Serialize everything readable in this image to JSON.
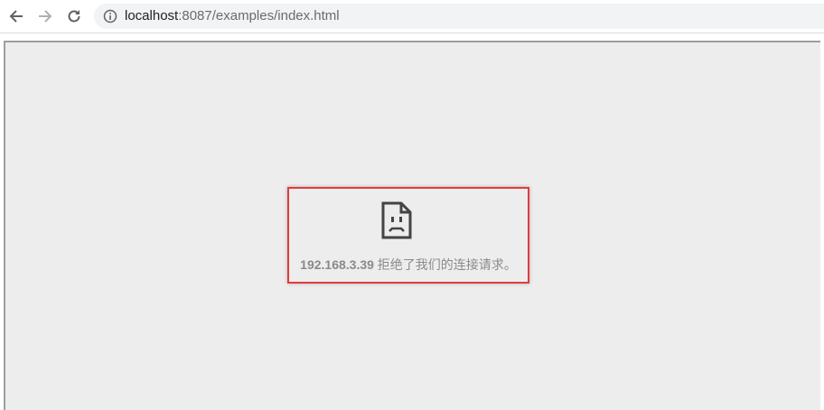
{
  "toolbar": {
    "back_icon": "arrow-left-icon",
    "forward_icon": "arrow-right-icon",
    "reload_icon": "reload-icon",
    "info_icon": "info-icon"
  },
  "address_bar": {
    "host": "localhost",
    "rest": ":8087/examples/index.html"
  },
  "error": {
    "icon": "sad-document-icon",
    "ip": "192.168.3.39",
    "message": " 拒绝了我们的连接请求。"
  },
  "colors": {
    "highlight_border": "#e33b3b",
    "page_background": "#ededed"
  }
}
